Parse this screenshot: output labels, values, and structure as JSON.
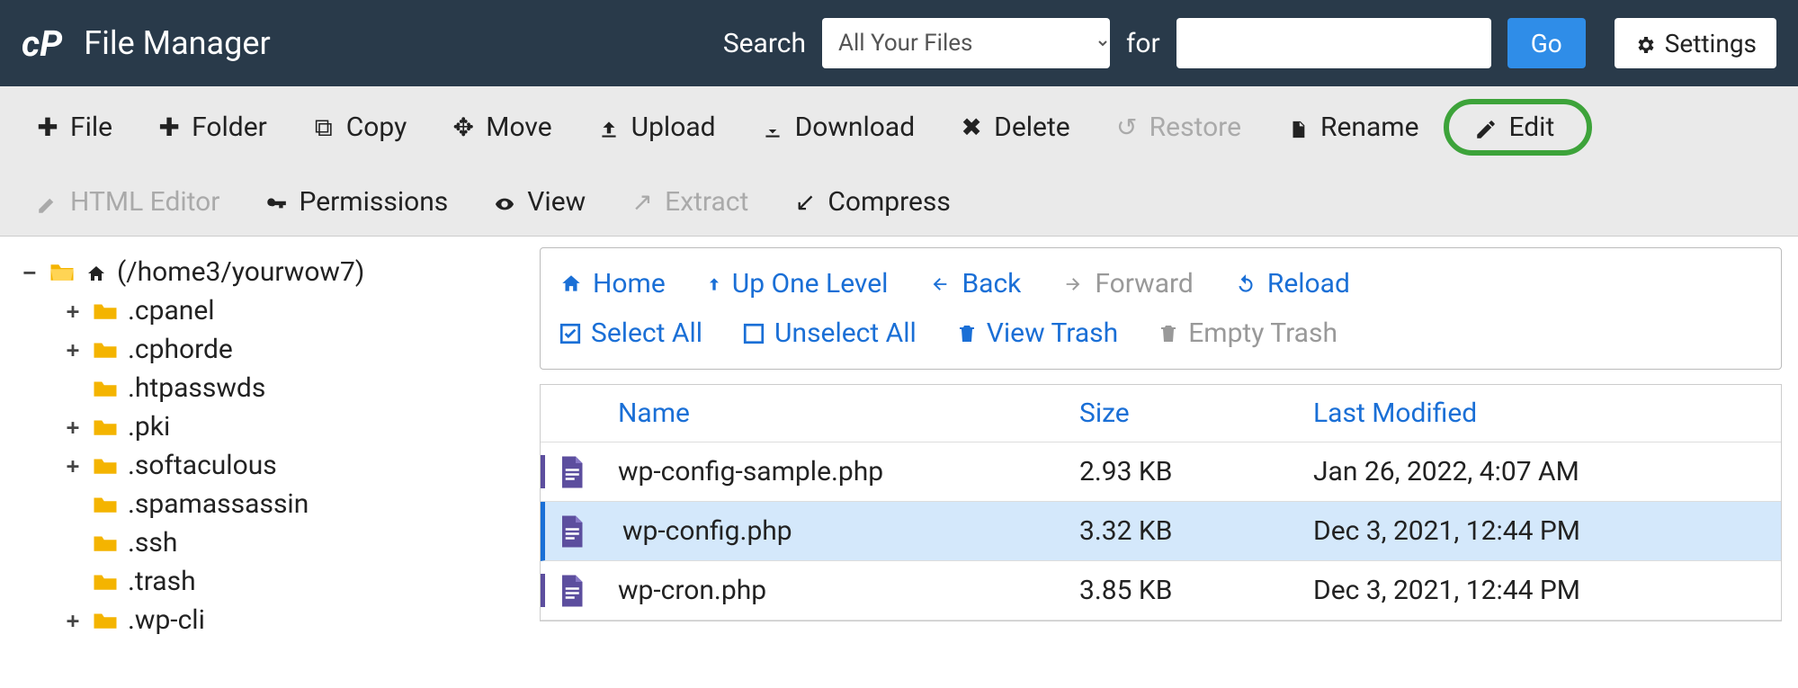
{
  "header": {
    "title": "File Manager",
    "search_label": "Search",
    "for_label": "for",
    "scope_selected": "All Your Files",
    "search_value": "",
    "go_label": "Go",
    "settings_label": "Settings"
  },
  "toolbar": {
    "file": "File",
    "folder": "Folder",
    "copy": "Copy",
    "move": "Move",
    "upload": "Upload",
    "download": "Download",
    "delete": "Delete",
    "restore": "Restore",
    "rename": "Rename",
    "edit": "Edit",
    "html_editor": "HTML Editor",
    "permissions": "Permissions",
    "view": "View",
    "extract": "Extract",
    "compress": "Compress"
  },
  "tree": {
    "root_label": "(/home3/yourwow7)",
    "items": [
      {
        "label": ".cpanel",
        "expandable": true
      },
      {
        "label": ".cphorde",
        "expandable": true
      },
      {
        "label": ".htpasswds",
        "expandable": false
      },
      {
        "label": ".pki",
        "expandable": true
      },
      {
        "label": ".softaculous",
        "expandable": true
      },
      {
        "label": ".spamassassin",
        "expandable": false
      },
      {
        "label": ".ssh",
        "expandable": false
      },
      {
        "label": ".trash",
        "expandable": false
      },
      {
        "label": ".wp-cli",
        "expandable": true
      }
    ]
  },
  "nav": {
    "home": "Home",
    "up": "Up One Level",
    "back": "Back",
    "forward": "Forward",
    "reload": "Reload",
    "select_all": "Select All",
    "unselect_all": "Unselect All",
    "view_trash": "View Trash",
    "empty_trash": "Empty Trash"
  },
  "table": {
    "headers": {
      "name": "Name",
      "size": "Size",
      "modified": "Last Modified"
    },
    "rows": [
      {
        "name": "wp-config-sample.php",
        "size": "2.93 KB",
        "modified": "Jan 26, 2022, 4:07 AM",
        "selected": false
      },
      {
        "name": "wp-config.php",
        "size": "3.32 KB",
        "modified": "Dec 3, 2021, 12:44 PM",
        "selected": true
      },
      {
        "name": "wp-cron.php",
        "size": "3.85 KB",
        "modified": "Dec 3, 2021, 12:44 PM",
        "selected": false
      }
    ]
  }
}
